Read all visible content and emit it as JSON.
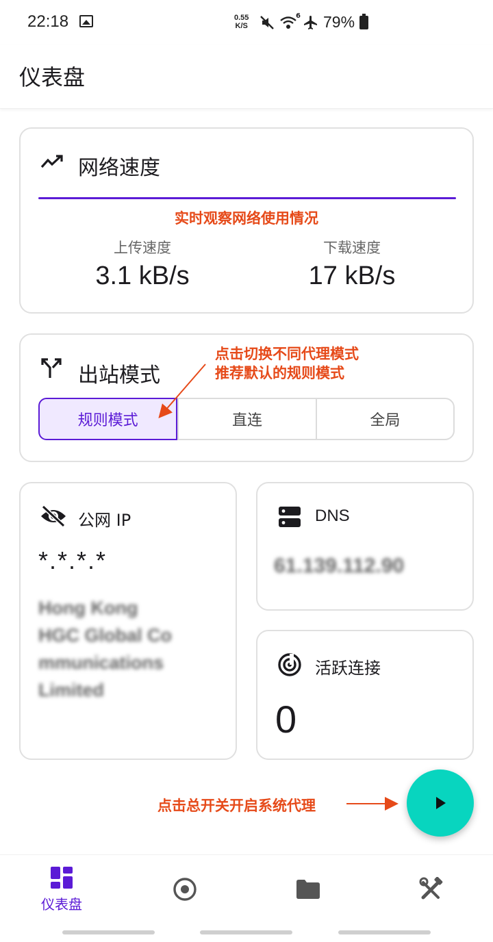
{
  "status_bar": {
    "time": "22:18",
    "net_speed_value": "0.55",
    "net_speed_unit": "K/S",
    "wifi_sub": "6",
    "battery": "79%"
  },
  "app_bar": {
    "title": "仪表盘"
  },
  "network_card": {
    "title": "网络速度",
    "annotation": "实时观察网络使用情况",
    "upload_label": "上传速度",
    "upload_value": "3.1 kB/s",
    "download_label": "下载速度",
    "download_value": "17 kB/s",
    "accent_color": "#5b1bd6"
  },
  "mode_card": {
    "title": "出站模式",
    "annotation_line1": "点击切换不同代理模式",
    "annotation_line2": "推荐默认的规则模式",
    "modes": [
      {
        "label": "规则模式",
        "selected": true
      },
      {
        "label": "直连",
        "selected": false
      },
      {
        "label": "全局",
        "selected": false
      }
    ]
  },
  "ip_card": {
    "title": "公网 IP",
    "ip_value": "*.*.*.*",
    "location_lines": [
      "Hong Kong",
      "HGC Global Co",
      "mmunications",
      "Limited"
    ]
  },
  "dns_card": {
    "title": "DNS",
    "value": "61.139.112.90"
  },
  "connections_card": {
    "title": "活跃连接",
    "value": "0"
  },
  "fab": {
    "annotation": "点击总开关开启系统代理",
    "icon": "play-icon",
    "color": "#08d5bf"
  },
  "bottom_nav": {
    "items": [
      {
        "label": "仪表盘",
        "icon": "dashboard-icon",
        "active": true
      },
      {
        "label": "",
        "icon": "proxy-icon",
        "active": false
      },
      {
        "label": "",
        "icon": "folder-icon",
        "active": false
      },
      {
        "label": "",
        "icon": "tools-icon",
        "active": false
      }
    ]
  }
}
